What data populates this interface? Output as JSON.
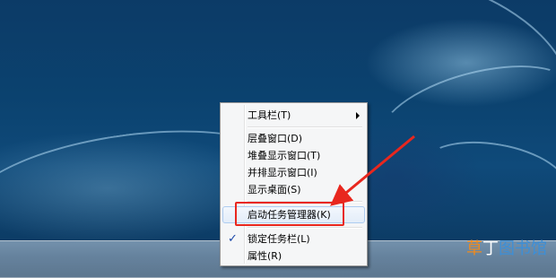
{
  "context_menu": {
    "items": [
      {
        "label": "工具栏(T)",
        "has_submenu": true
      },
      {
        "label": "层叠窗口(D)"
      },
      {
        "label": "堆叠显示窗口(T)"
      },
      {
        "label": "并排显示窗口(I)"
      },
      {
        "label": "显示桌面(S)"
      },
      {
        "label": "启动任务管理器(K)",
        "highlighted": true
      },
      {
        "label": "锁定任务栏(L)",
        "checked": true,
        "check_mark": "✓"
      },
      {
        "label": "属性(R)"
      }
    ]
  },
  "annotation": {
    "highlight_color": "#e8271e"
  },
  "watermark": {
    "part1": "草",
    "part2": "丁",
    "part3": "图书馆"
  }
}
